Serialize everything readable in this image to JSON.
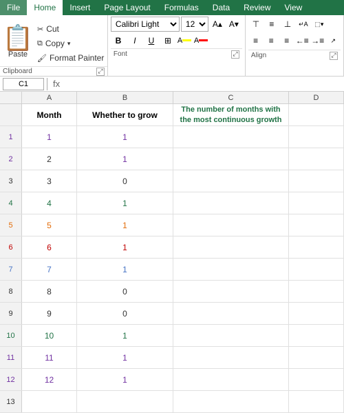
{
  "menubar": {
    "items": [
      "File",
      "Home",
      "Insert",
      "Page Layout",
      "Formulas",
      "Data",
      "Review",
      "View"
    ],
    "active": "Home"
  },
  "clipboard": {
    "paste_label": "Paste",
    "cut_label": "Cut",
    "copy_label": "Copy",
    "format_painter_label": "Format Painter",
    "group_label": "Clipboard"
  },
  "font": {
    "font_name": "Calibri Light",
    "font_size": "12",
    "bold_label": "B",
    "italic_label": "I",
    "underline_label": "U",
    "group_label": "Font"
  },
  "alignment": {
    "group_label": "Align"
  },
  "namebox": {
    "value": "C1"
  },
  "spreadsheet": {
    "col_headers": [
      "A",
      "B",
      "C",
      "D"
    ],
    "header_row": {
      "row_num": "",
      "col_a": "Month",
      "col_b": "Whether to grow",
      "col_c": "The number of months with the most continuous growth",
      "col_d": ""
    },
    "rows": [
      {
        "num": "1",
        "a": "1",
        "b": "1",
        "c": "",
        "a_color": "purple",
        "b_color": "purple"
      },
      {
        "num": "2",
        "a": "2",
        "b": "1",
        "c": "",
        "a_color": "default",
        "b_color": "purple"
      },
      {
        "num": "3",
        "a": "3",
        "b": "0",
        "c": "",
        "a_color": "default",
        "b_color": "default"
      },
      {
        "num": "4",
        "a": "4",
        "b": "1",
        "c": "",
        "a_color": "green",
        "b_color": "green"
      },
      {
        "num": "5",
        "a": "5",
        "b": "1",
        "c": "",
        "a_color": "orange",
        "b_color": "orange"
      },
      {
        "num": "6",
        "a": "6",
        "b": "1",
        "c": "",
        "a_color": "red",
        "b_color": "red"
      },
      {
        "num": "7",
        "a": "7",
        "b": "1",
        "c": "",
        "a_color": "blue",
        "b_color": "blue"
      },
      {
        "num": "8",
        "a": "8",
        "b": "0",
        "c": "",
        "a_color": "default",
        "b_color": "default"
      },
      {
        "num": "9",
        "a": "9",
        "b": "0",
        "c": "",
        "a_color": "default",
        "b_color": "default"
      },
      {
        "num": "10",
        "a": "10",
        "b": "1",
        "c": "",
        "a_color": "green",
        "b_color": "green"
      },
      {
        "num": "11",
        "a": "11",
        "b": "1",
        "c": "",
        "a_color": "purple",
        "b_color": "purple"
      },
      {
        "num": "12",
        "a": "12",
        "b": "1",
        "c": "",
        "a_color": "purple",
        "b_color": "purple"
      },
      {
        "num": "13",
        "a": "",
        "b": "",
        "c": "",
        "a_color": "default",
        "b_color": "default"
      }
    ],
    "row_header_colors": [
      "#7030a0",
      "#7030a0",
      "#333",
      "#217346",
      "#e36c09",
      "#c00000",
      "#4472c4",
      "#333",
      "#333",
      "#217346",
      "#7030a0",
      "#7030a0",
      "#333"
    ]
  }
}
